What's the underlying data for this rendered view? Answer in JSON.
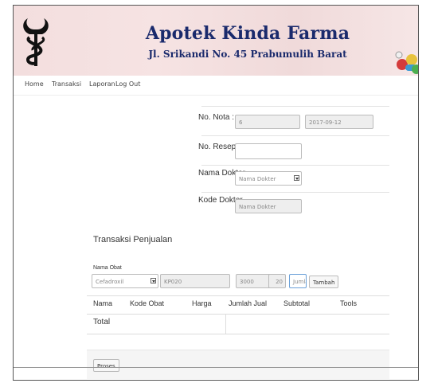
{
  "header": {
    "title": "Apotek Kinda Farma",
    "address": "Jl. Srikandi No. 45 Prabumulih Barat"
  },
  "nav": {
    "items": [
      "Home",
      "Transaksi",
      "Laporan",
      "Log Out"
    ]
  },
  "form": {
    "nota_label": "No. Nota :",
    "nota_value": "6",
    "date_value": "2017-09-12",
    "resep_label": "No. Resep:",
    "resep_value": "",
    "dokter_label": "Nama Dokter",
    "dokter_select": "Nama Dokter",
    "kode_dokter_label": "Kode Dokter",
    "kode_dokter_placeholder": "Nama Dokter"
  },
  "transaksi": {
    "title": "Transaksi Penjualan",
    "nama_obat_label": "Nama Obat",
    "obat_select": "Cefadroxil",
    "kode_obat": "KP020",
    "harga": "3000",
    "stok": "20",
    "jumlah_placeholder": "Jumlah",
    "tambah_label": "Tambah"
  },
  "table": {
    "headers": [
      "Nama",
      "Kode Obat",
      "Harga",
      "Jumlah Jual",
      "Subtotal",
      "Tools"
    ],
    "total_label": "Total"
  },
  "footer": {
    "proses_label": "Proses"
  },
  "colors": {
    "title": "#1a2a6c",
    "header_bg": "#f3dede"
  }
}
